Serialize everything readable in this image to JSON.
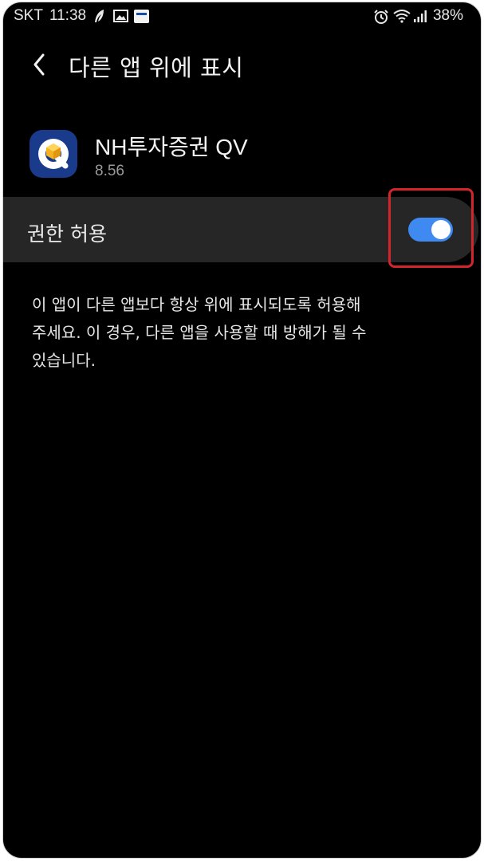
{
  "status_bar": {
    "carrier": "SKT",
    "time": "11:38",
    "battery": "38%",
    "icons": [
      "feather-icon",
      "image-icon",
      "notification-icon",
      "alarm-icon",
      "wifi-icon",
      "signal-icon"
    ]
  },
  "header": {
    "back_icon": "chevron-left-icon",
    "title": "다른 앱 위에 표시"
  },
  "app": {
    "name": "NH투자증권 QV",
    "version": "8.56",
    "icon": "nh-qv-app-icon",
    "icon_color": "#1a3a8c"
  },
  "permission": {
    "label": "권한 허용",
    "enabled": true,
    "toggle_color": "#3e8af0",
    "highlight_color": "#d4252c"
  },
  "description": {
    "line1": "이 앱이 다른 앱보다 항상 위에 표시되도록 허용해",
    "line2": "주세요. 이 경우, 다른 앱을 사용할 때 방해가 될 수",
    "line3": "있습니다."
  }
}
